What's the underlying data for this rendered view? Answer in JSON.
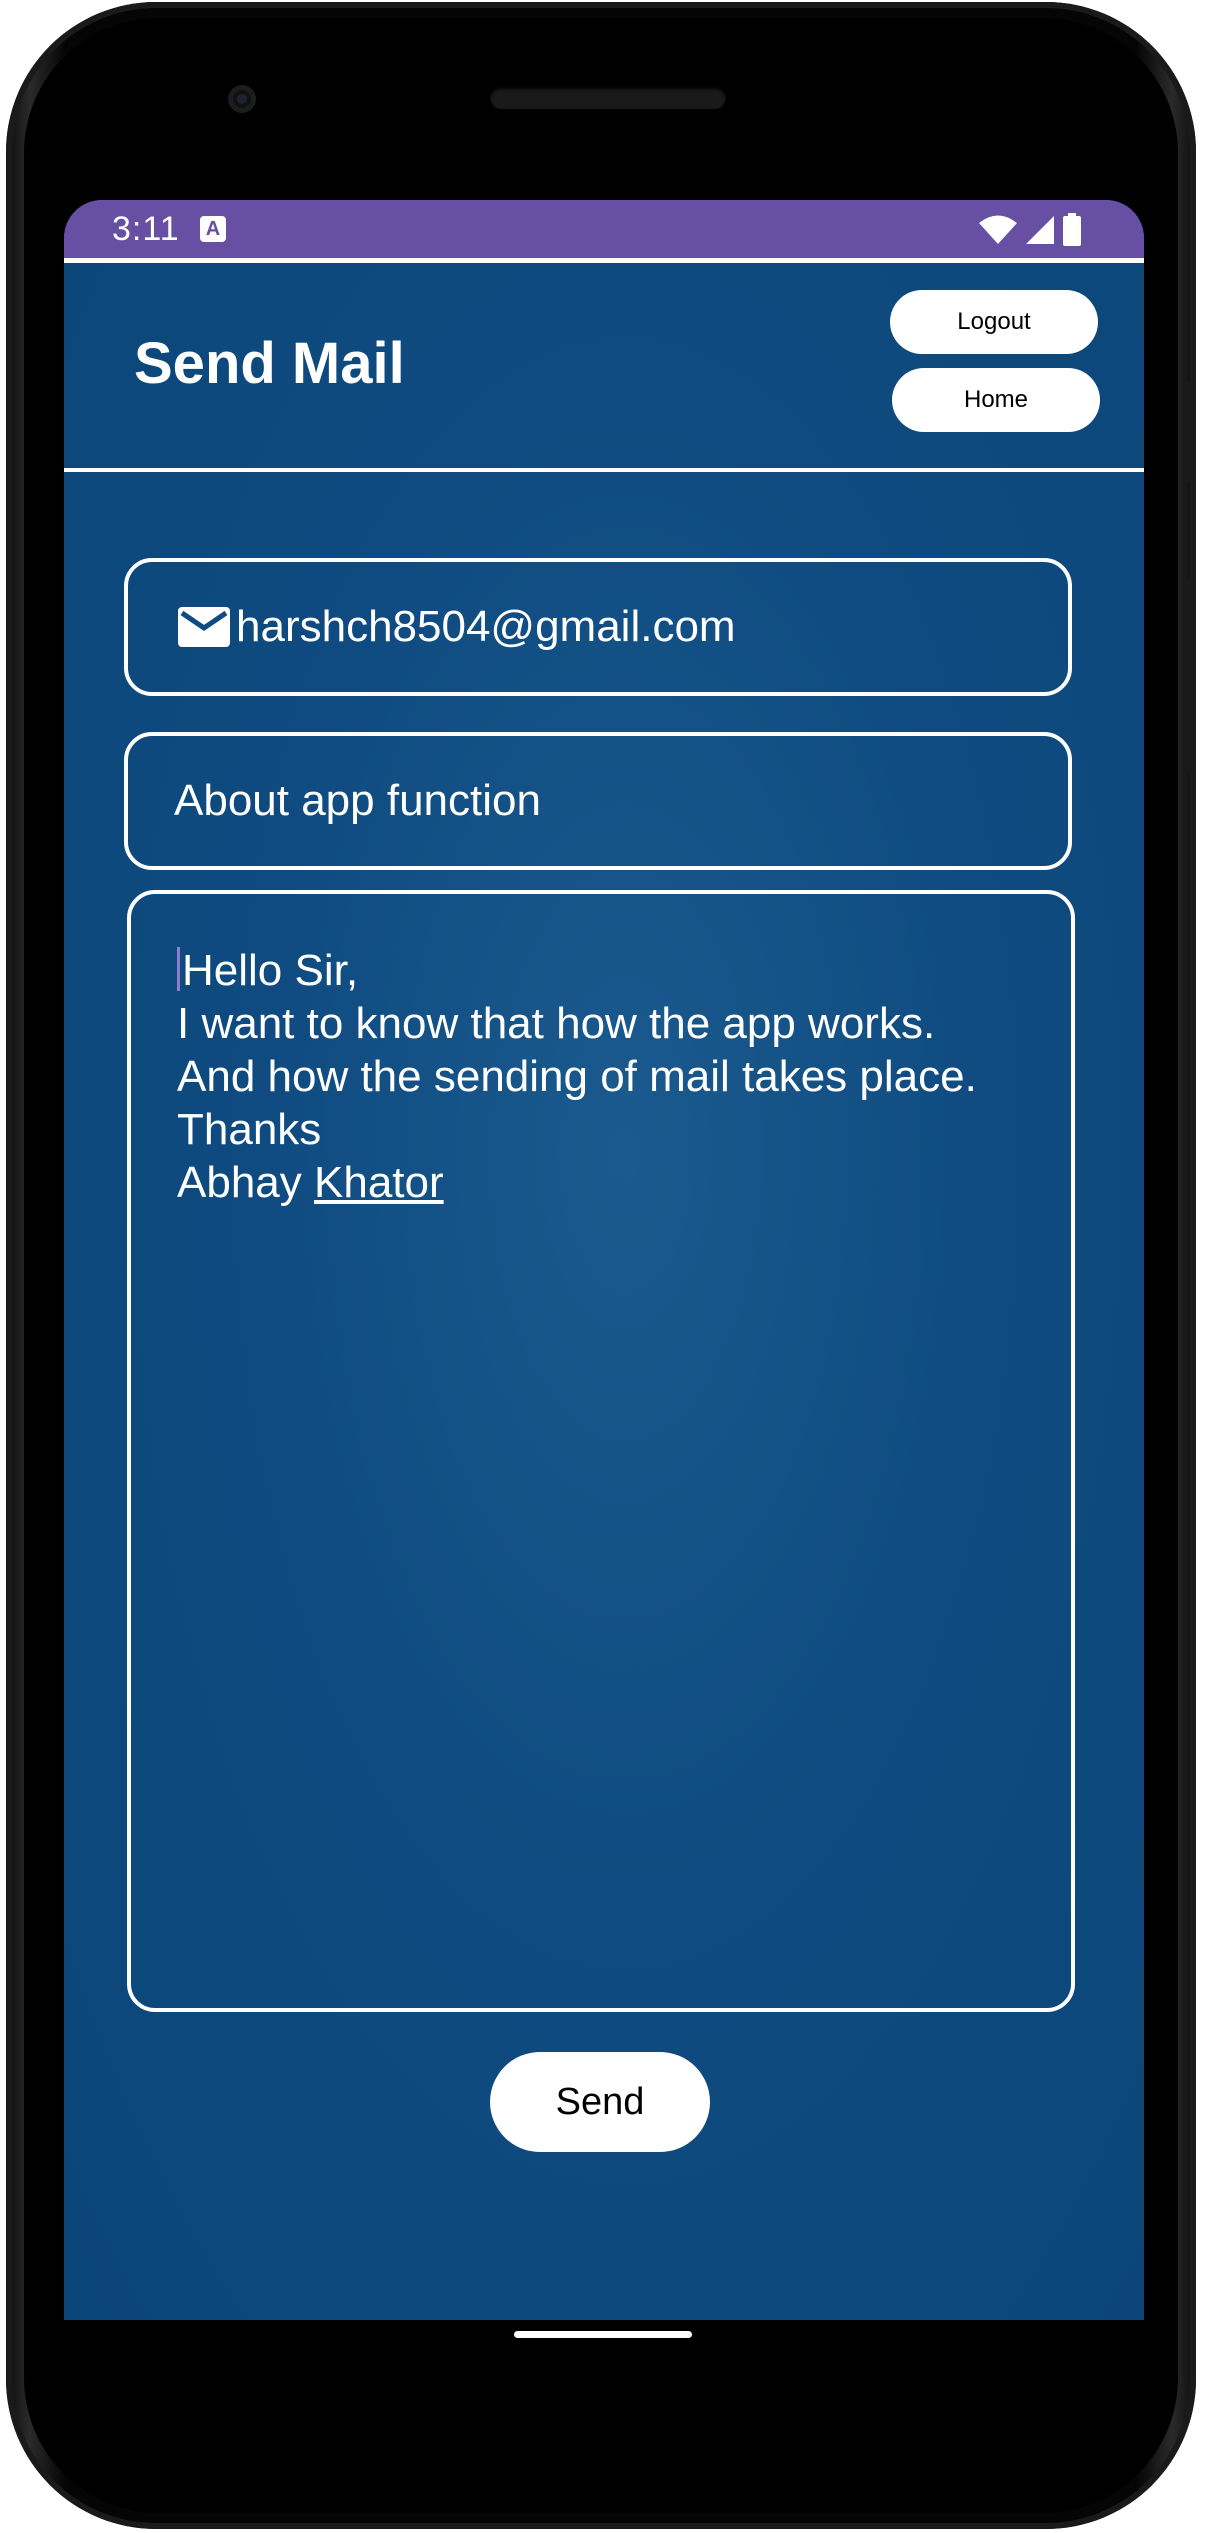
{
  "status_bar": {
    "time": "3:11",
    "notification_icon": "A",
    "icons": [
      "wifi-icon",
      "signal-icon",
      "battery-icon"
    ],
    "color": "#6750a4"
  },
  "header": {
    "title": "Send Mail",
    "logout_label": "Logout",
    "home_label": "Home"
  },
  "form": {
    "email": {
      "icon": "mail-icon",
      "value": "harshch8504@gmail.com"
    },
    "subject": {
      "value": "About app function"
    },
    "body": {
      "lines": [
        "Hello Sir,",
        "I want to know that how the app works.",
        "And how the sending of mail takes place.",
        "Thanks"
      ],
      "signature_first": "Abhay",
      "signature_last": "Khator"
    },
    "send_label": "Send"
  },
  "colors": {
    "background": "#0f4b80",
    "accent": "#6750a4",
    "foreground": "#ffffff"
  }
}
